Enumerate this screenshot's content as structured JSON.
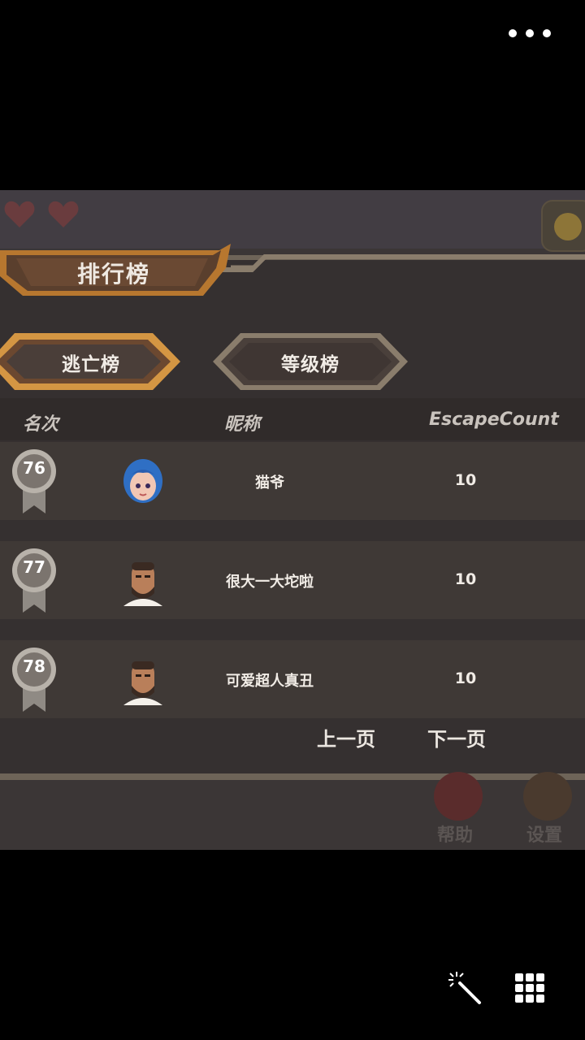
{
  "screen": {
    "more_icon": "more-horizontal-icon"
  },
  "leaderboard": {
    "title": "排行榜",
    "tabs": [
      {
        "label": "逃亡榜",
        "active": true
      },
      {
        "label": "等级榜",
        "active": false
      }
    ],
    "columns": {
      "rank": "名次",
      "nickname": "昵称",
      "count": "EscapeCount"
    },
    "rows": [
      {
        "rank": "76",
        "avatar": "blue-hair-girl-avatar",
        "nickname": "猫爷",
        "count": "10"
      },
      {
        "rank": "77",
        "avatar": "bearded-man-avatar",
        "nickname": "很大一大坨啦",
        "count": "10"
      },
      {
        "rank": "78",
        "avatar": "bearded-man-avatar",
        "nickname": "可爱超人真丑",
        "count": "10"
      }
    ],
    "pager": {
      "prev": "上一页",
      "next": "下一页"
    }
  },
  "background_buttons": {
    "help": "帮助",
    "settings": "设置"
  },
  "bottom_toolbar": {
    "edit_icon": "magic-wand-icon",
    "grid_icon": "grid-icon"
  },
  "colors": {
    "panel": "#353030",
    "row": "#3f3936",
    "frame": "#6e6458",
    "gold": "#cf8f3a"
  }
}
